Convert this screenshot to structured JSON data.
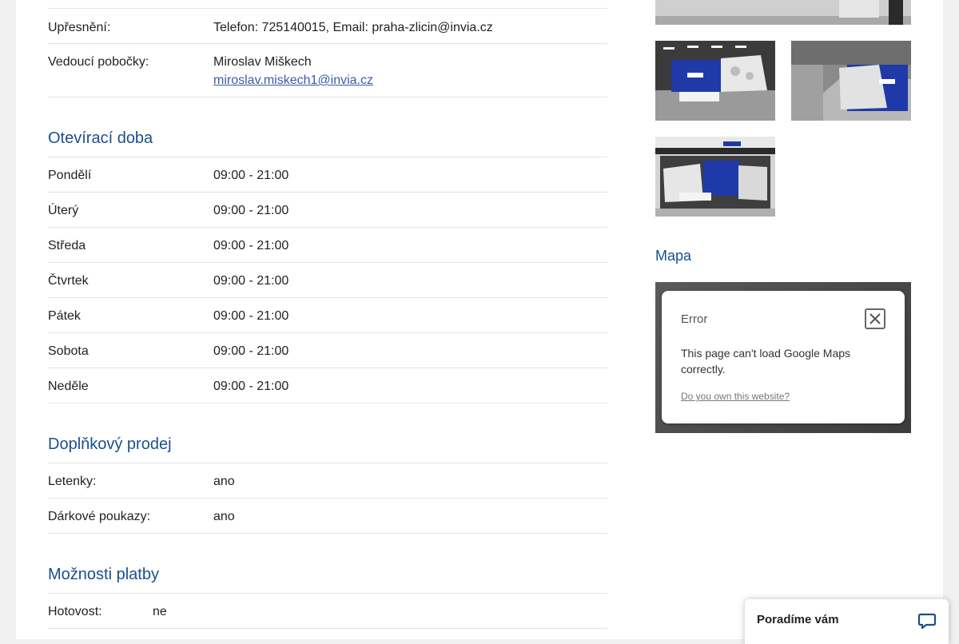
{
  "details": {
    "note_label": "Upřesnění:",
    "note_value": "Telefon: 725140015, Email: praha-zlicin@invia.cz",
    "manager_label": "Vedoucí pobočky:",
    "manager_name": "Miroslav Miškech",
    "manager_email": "miroslav.miskech1@invia.cz"
  },
  "hours": {
    "title": "Otevírací doba",
    "days": [
      {
        "day": "Pondělí",
        "time": "09:00 - 21:00"
      },
      {
        "day": "Úterý",
        "time": "09:00 - 21:00"
      },
      {
        "day": "Středa",
        "time": "09:00 - 21:00"
      },
      {
        "day": "Čtvrtek",
        "time": "09:00 - 21:00"
      },
      {
        "day": "Pátek",
        "time": "09:00 - 21:00"
      },
      {
        "day": "Sobota",
        "time": "09:00 - 21:00"
      },
      {
        "day": "Neděle",
        "time": "09:00 - 21:00"
      }
    ]
  },
  "extras": {
    "title": "Doplňkový prodej",
    "items": [
      {
        "label": "Letenky:",
        "value": "ano"
      },
      {
        "label": "Dárkové poukazy:",
        "value": "ano"
      }
    ]
  },
  "payment": {
    "title": "Možnosti platby",
    "items": [
      {
        "label": "Hotovost:",
        "value": "ne"
      }
    ]
  },
  "map": {
    "title": "Mapa",
    "error_title": "Error",
    "error_message": "This page can't load Google Maps correctly.",
    "error_link": "Do you own this website?"
  },
  "chat": {
    "label": "Poradíme vám"
  },
  "colors": {
    "heading": "#1a4f8f",
    "link": "#3a5ca8",
    "brand_blue": "#1f3aa8"
  }
}
